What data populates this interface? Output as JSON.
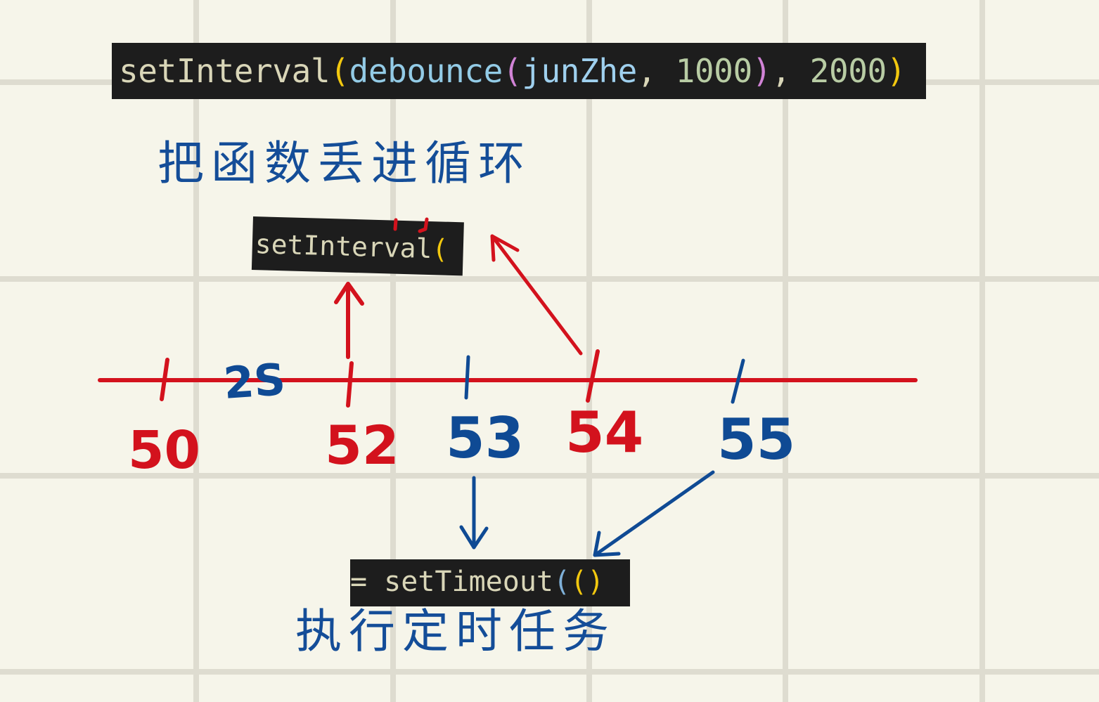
{
  "code": {
    "main": {
      "fn": "setInterval",
      "open": "(",
      "inner_fn": "debounce",
      "inner_open": "(",
      "arg": "junZhe",
      "sep": ", ",
      "delay": "1000",
      "inner_close": ")",
      "sep2": ", ",
      "interval": "2000",
      "close": ")"
    },
    "interval_snippet": {
      "fn": "setInterval",
      "open": "("
    },
    "timeout_snippet": {
      "prefix": "= ",
      "fn": "setTimeout",
      "open": "(",
      "inner": "()"
    }
  },
  "annotations": {
    "top_note": "把函数丢进循环",
    "bottom_note": "执行定时任务"
  },
  "timeline": {
    "ticks": [
      {
        "label": "50",
        "color": "red"
      },
      {
        "label": "52",
        "color": "red"
      },
      {
        "label": "53",
        "color": "blue"
      },
      {
        "label": "54",
        "color": "red"
      },
      {
        "label": "55",
        "color": "blue"
      }
    ],
    "interval_note": "2S"
  },
  "colors": {
    "background": "#f6f5ea",
    "grid_line": "#dedcd0",
    "red_ink": "#d3121d",
    "blue_ink": "#0f4a94",
    "code_bg": "#1d1d1d"
  }
}
